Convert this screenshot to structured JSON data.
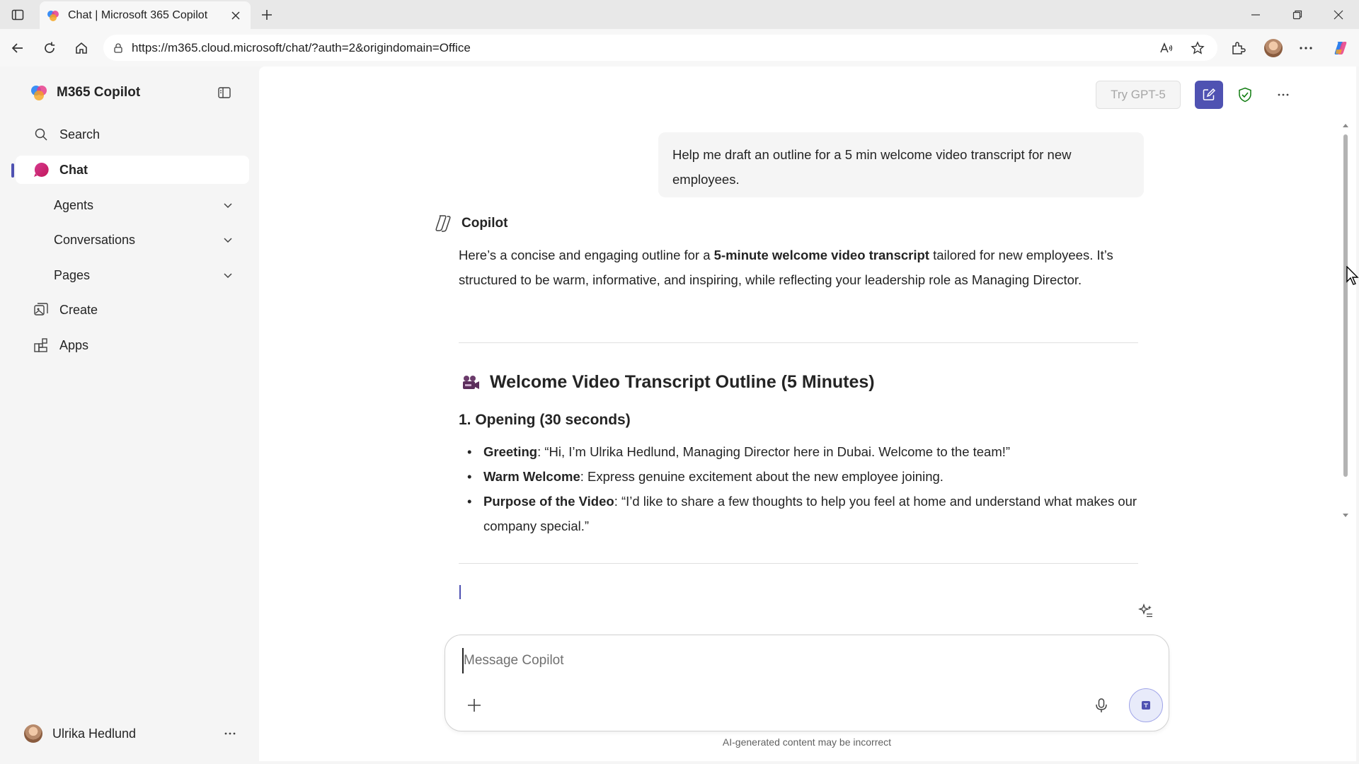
{
  "browser": {
    "tab_title": "Chat | Microsoft 365 Copilot",
    "url": "https://m365.cloud.microsoft/chat/?auth=2&origindomain=Office"
  },
  "sidebar": {
    "brand": "M365 Copilot",
    "search_label": "Search",
    "chat_label": "Chat",
    "sub_items": [
      {
        "label": "Agents"
      },
      {
        "label": "Conversations"
      },
      {
        "label": "Pages"
      }
    ],
    "create_label": "Create",
    "apps_label": "Apps",
    "user_name": "Ulrika Hedlund"
  },
  "header": {
    "try_gpt_label": "Try GPT-5"
  },
  "conversation": {
    "user_prompt": "Help me draft an outline for a 5 min welcome video transcript for new employees.",
    "assistant_name": "Copilot",
    "intro": {
      "before": "Here’s a concise and engaging outline for a ",
      "bold": "5-minute welcome video transcript",
      "after": " tailored for new employees. It’s structured to be warm, informative, and inspiring, while reflecting your leadership role as Managing Director."
    },
    "heading": "Welcome Video Transcript Outline (5 Minutes)",
    "section_title": "1. Opening (30 seconds)",
    "bullets": [
      {
        "label": "Greeting",
        "text": ": “Hi, I’m Ulrika Hedlund, Managing Director here in Dubai. Welcome to the team!”"
      },
      {
        "label": "Warm Welcome",
        "text": ": Express genuine excitement about the new employee joining."
      },
      {
        "label": "Purpose of the Video",
        "text": ": “I’d like to share a few thoughts to help you feel at home and understand what makes our company special.”"
      }
    ]
  },
  "composer": {
    "placeholder": "Message Copilot",
    "value": ""
  },
  "footer": {
    "disclaimer": "AI-generated content may be incorrect"
  },
  "colors": {
    "accent": "#4f52b2",
    "background": "#f5f5f5",
    "surface": "#ffffff"
  },
  "icons": [
    "tab-sidebar-icon",
    "copilot-favicon",
    "close-icon",
    "plus-icon",
    "minimize-icon",
    "restore-icon",
    "back-icon",
    "refresh-icon",
    "home-icon",
    "lock-icon",
    "read-aloud-icon",
    "star-icon",
    "extensions-icon",
    "more-icon",
    "copilot-icon",
    "sidebar-collapse-icon",
    "search-icon",
    "chat-icon",
    "chevron-down-icon",
    "create-icon",
    "apps-icon",
    "new-chat-icon",
    "shield-icon",
    "movie-camera-icon",
    "sparkle-icon",
    "mic-icon",
    "send-icon"
  ]
}
